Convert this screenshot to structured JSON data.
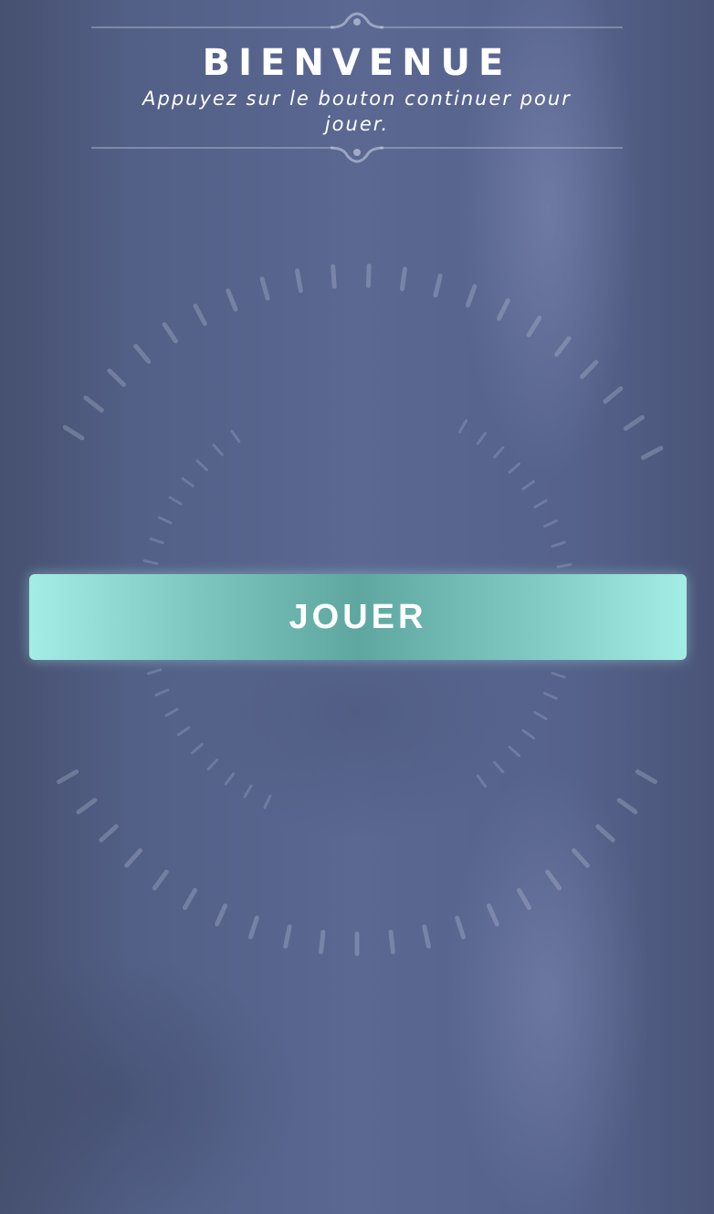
{
  "header": {
    "title": "BIENVENUE",
    "subtitle": "Appuyez sur le bouton continuer pour jouer."
  },
  "play_button": {
    "label": "JOUER"
  },
  "colors": {
    "background": "#525f86",
    "button_edge": "#a4ece6",
    "button_center": "#5ea7a0",
    "text": "#ffffff"
  },
  "icons": [
    "header-top-ornament-icon",
    "header-bottom-ornament-icon",
    "dial-ticks-decoration"
  ]
}
